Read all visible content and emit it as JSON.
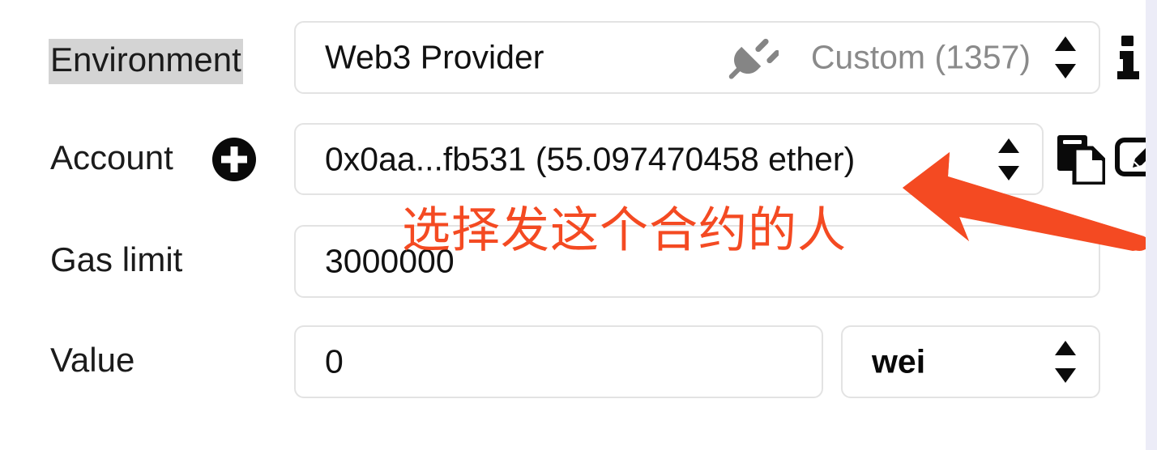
{
  "colors": {
    "annotation": "#f44a22",
    "field_border": "#e3e3e3",
    "label_highlight": "#d4d4d4",
    "muted_text": "#8a8a8a",
    "page_edge_strip": "#ececf7"
  },
  "form": {
    "rows": [
      {
        "label": "Environment",
        "value": "Web3 Provider",
        "network": "Custom (1357)",
        "icons": [
          "plug-icon",
          "spinner-icon",
          "info-icon"
        ]
      },
      {
        "label": "Account",
        "value": "0x0aa...fb531 (55.097470458 ether)",
        "icons": [
          "plus-circle-icon",
          "spinner-icon",
          "copy-icon",
          "sign-message-icon"
        ]
      },
      {
        "label": "Gas limit",
        "value": "3000000",
        "icons": []
      },
      {
        "label": "Value",
        "value": "0",
        "unit": "wei",
        "icons": [
          "spinner-icon"
        ]
      }
    ]
  },
  "annotation": {
    "text": "选择发这个合约的人",
    "arrow": "arrow-pointing-up-left-to-account-dropdown"
  }
}
